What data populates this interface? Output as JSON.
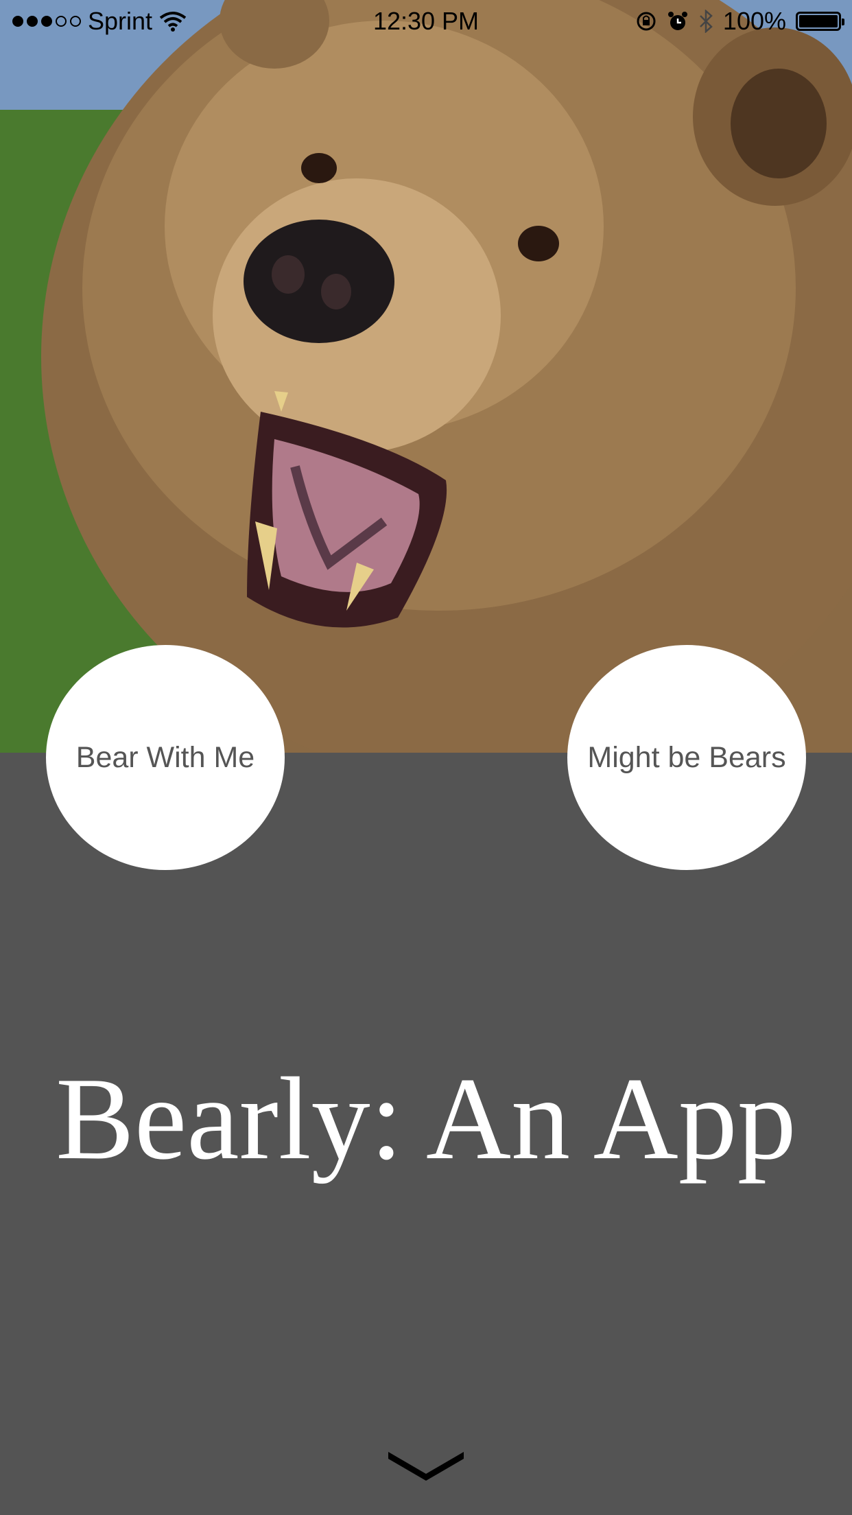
{
  "status_bar": {
    "carrier": "Sprint",
    "time": "12:30 PM",
    "battery": "100%",
    "signal_bars_filled": 3,
    "signal_bars_total": 5
  },
  "hero": {
    "image": "bear-photo"
  },
  "buttons": {
    "left_label": "Bear With Me",
    "right_label": "Might be Bears"
  },
  "title": "Bearly: An App",
  "footer": {
    "icon": "chevron-down-icon"
  },
  "colors": {
    "background": "#545454",
    "button_fill": "#ffffff",
    "button_text": "#555555",
    "title_text": "#ffffff"
  }
}
